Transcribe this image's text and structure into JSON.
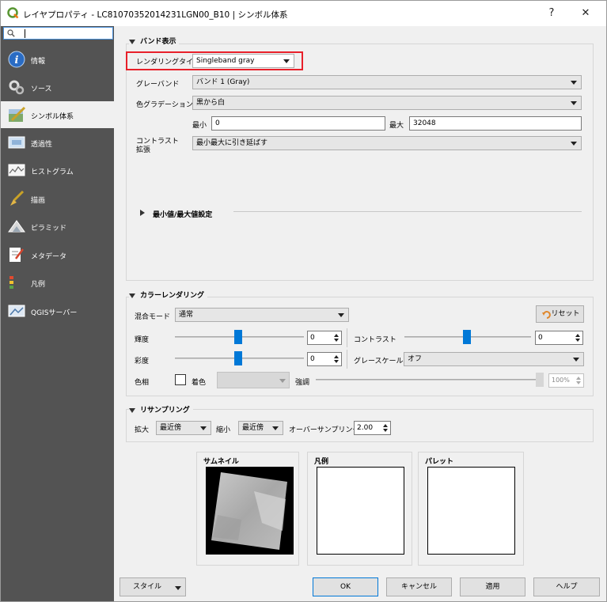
{
  "window": {
    "title": "レイヤプロパティ - LC81070352014231LGN00_B10 | シンボル体系",
    "help_button": "?",
    "close_button": "✕"
  },
  "sidebar": {
    "search_placeholder": "",
    "items": [
      {
        "label": "情報",
        "icon": "info-icon"
      },
      {
        "label": "ソース",
        "icon": "source-icon"
      },
      {
        "label": "シンボル体系",
        "icon": "symbology-icon"
      },
      {
        "label": "透過性",
        "icon": "transparency-icon"
      },
      {
        "label": "ヒストグラム",
        "icon": "histogram-icon"
      },
      {
        "label": "描画",
        "icon": "rendering-icon"
      },
      {
        "label": "ピラミッド",
        "icon": "pyramids-icon"
      },
      {
        "label": "メタデータ",
        "icon": "metadata-icon"
      },
      {
        "label": "凡例",
        "icon": "legend-icon"
      },
      {
        "label": "QGISサーバー",
        "icon": "qgis-server-icon"
      }
    ]
  },
  "band_rendering": {
    "header": "バンド表示",
    "render_type_label": "レンダリングタイプ",
    "render_type_value": "Singleband gray",
    "gray_band_label": "グレーバンド",
    "gray_band_value": "バンド 1 (Gray)",
    "color_gradient_label": "色グラデーション",
    "color_gradient_value": "黒から白",
    "min_label": "最小",
    "min_value": "0",
    "max_label": "最大",
    "max_value": "32048",
    "contrast_label_1": "コントラスト",
    "contrast_label_2": "拡張",
    "contrast_value": "最小最大に引き延ばす",
    "minmax_header": "最小値/最大値設定"
  },
  "color_rendering": {
    "header": "カラーレンダリング",
    "blend_label": "混合モード",
    "blend_value": "通常",
    "reset_label": "リセット",
    "brightness_label": "輝度",
    "brightness_value": "0",
    "contrast_label": "コントラスト",
    "contrast_value": "0",
    "saturation_label": "彩度",
    "saturation_value": "0",
    "grayscale_label": "グレースケール",
    "grayscale_value": "オフ",
    "hue_label": "色相",
    "colorize_label": "着色",
    "strength_label": "強調",
    "strength_value": "100%"
  },
  "resampling": {
    "header": "リサンプリング",
    "zoomed_in_label": "拡大",
    "zoomed_in_value": "最近傍",
    "zoomed_out_label": "縮小",
    "zoomed_out_value": "最近傍",
    "oversampling_label": "オーバーサンプリング",
    "oversampling_value": "2.00"
  },
  "previews": {
    "thumbnail_title": "サムネイル",
    "legend_title": "凡例",
    "palette_title": "パレット"
  },
  "footer": {
    "style_label": "スタイル",
    "ok_label": "OK",
    "cancel_label": "キャンセル",
    "apply_label": "適用",
    "help_label": "ヘルプ"
  },
  "colors": {
    "sidebar_bg": "#535353",
    "accent": "#0078d7",
    "highlight": "#e8202a"
  }
}
